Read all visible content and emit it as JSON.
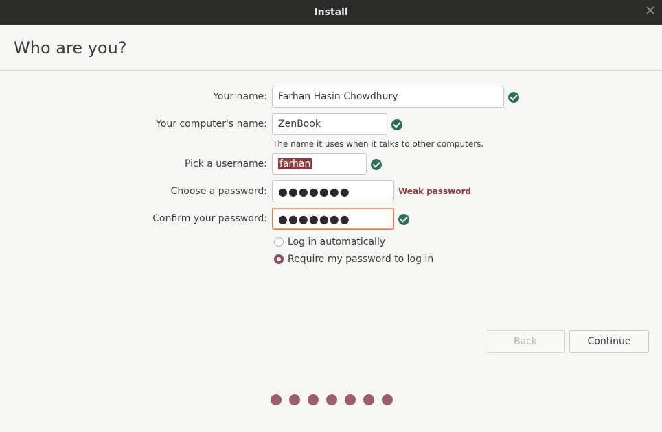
{
  "window": {
    "title": "Install"
  },
  "page": {
    "title": "Who are you?"
  },
  "form": {
    "name_label": "Your name:",
    "name_value": "Farhan Hasin Chowdhury",
    "computer_label": "Your computer's name:",
    "computer_value": "ZenBook",
    "computer_hint": "The name it uses when it talks to other computers.",
    "username_label": "Pick a username:",
    "username_value": "farhan",
    "password_label": "Choose a password:",
    "password_value": "●●●●●●●",
    "password_strength": "Weak password",
    "confirm_label": "Confirm your password:",
    "confirm_value": "●●●●●●●"
  },
  "login_options": {
    "auto_label": "Log in automatically",
    "auto_selected": false,
    "require_label": "Require my password to log in",
    "require_selected": true
  },
  "buttons": {
    "back_label": "Back",
    "back_enabled": false,
    "continue_label": "Continue"
  },
  "progress": {
    "total_steps": 7
  },
  "colors": {
    "titlebar": "#2c2c2a",
    "check": "#2f6f5a",
    "accent": "#8b3b3b",
    "focus": "#e97a3f",
    "progress_dot": "#9c5c72"
  },
  "icons": {
    "valid": "check-circle-icon",
    "close": "close-icon"
  }
}
